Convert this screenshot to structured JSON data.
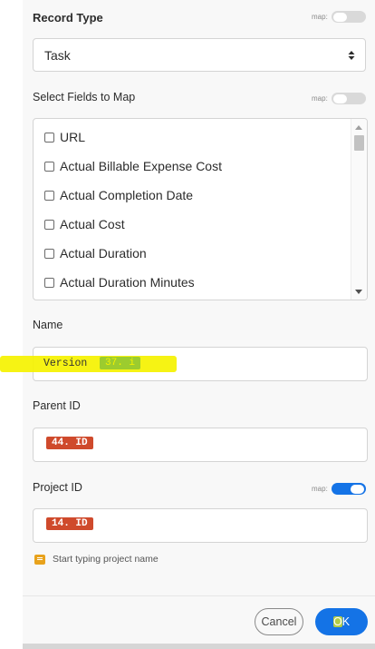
{
  "record_type": {
    "label": "Record Type",
    "map_label": "map:",
    "map_on": false,
    "selected": "Task"
  },
  "select_fields": {
    "label": "Select Fields to Map",
    "map_label": "map:",
    "map_on": false,
    "items": [
      "URL",
      "Actual Billable Expense Cost",
      "Actual Completion Date",
      "Actual Cost",
      "Actual Duration",
      "Actual Duration Minutes"
    ]
  },
  "name": {
    "label": "Name",
    "text": "Version",
    "chip": "37. i"
  },
  "parent_id": {
    "label": "Parent ID",
    "chip": "44. ID"
  },
  "project_id": {
    "label": "Project ID",
    "map_label": "map:",
    "map_on": true,
    "chip": "14. ID",
    "hint": "Start typing project name"
  },
  "footer": {
    "cancel": "Cancel",
    "ok": "OK"
  },
  "colors": {
    "accent": "#1473e6",
    "chip_red": "#cf4a2c",
    "highlight": "#f5f200",
    "chip_green": "#9ccc2e"
  }
}
